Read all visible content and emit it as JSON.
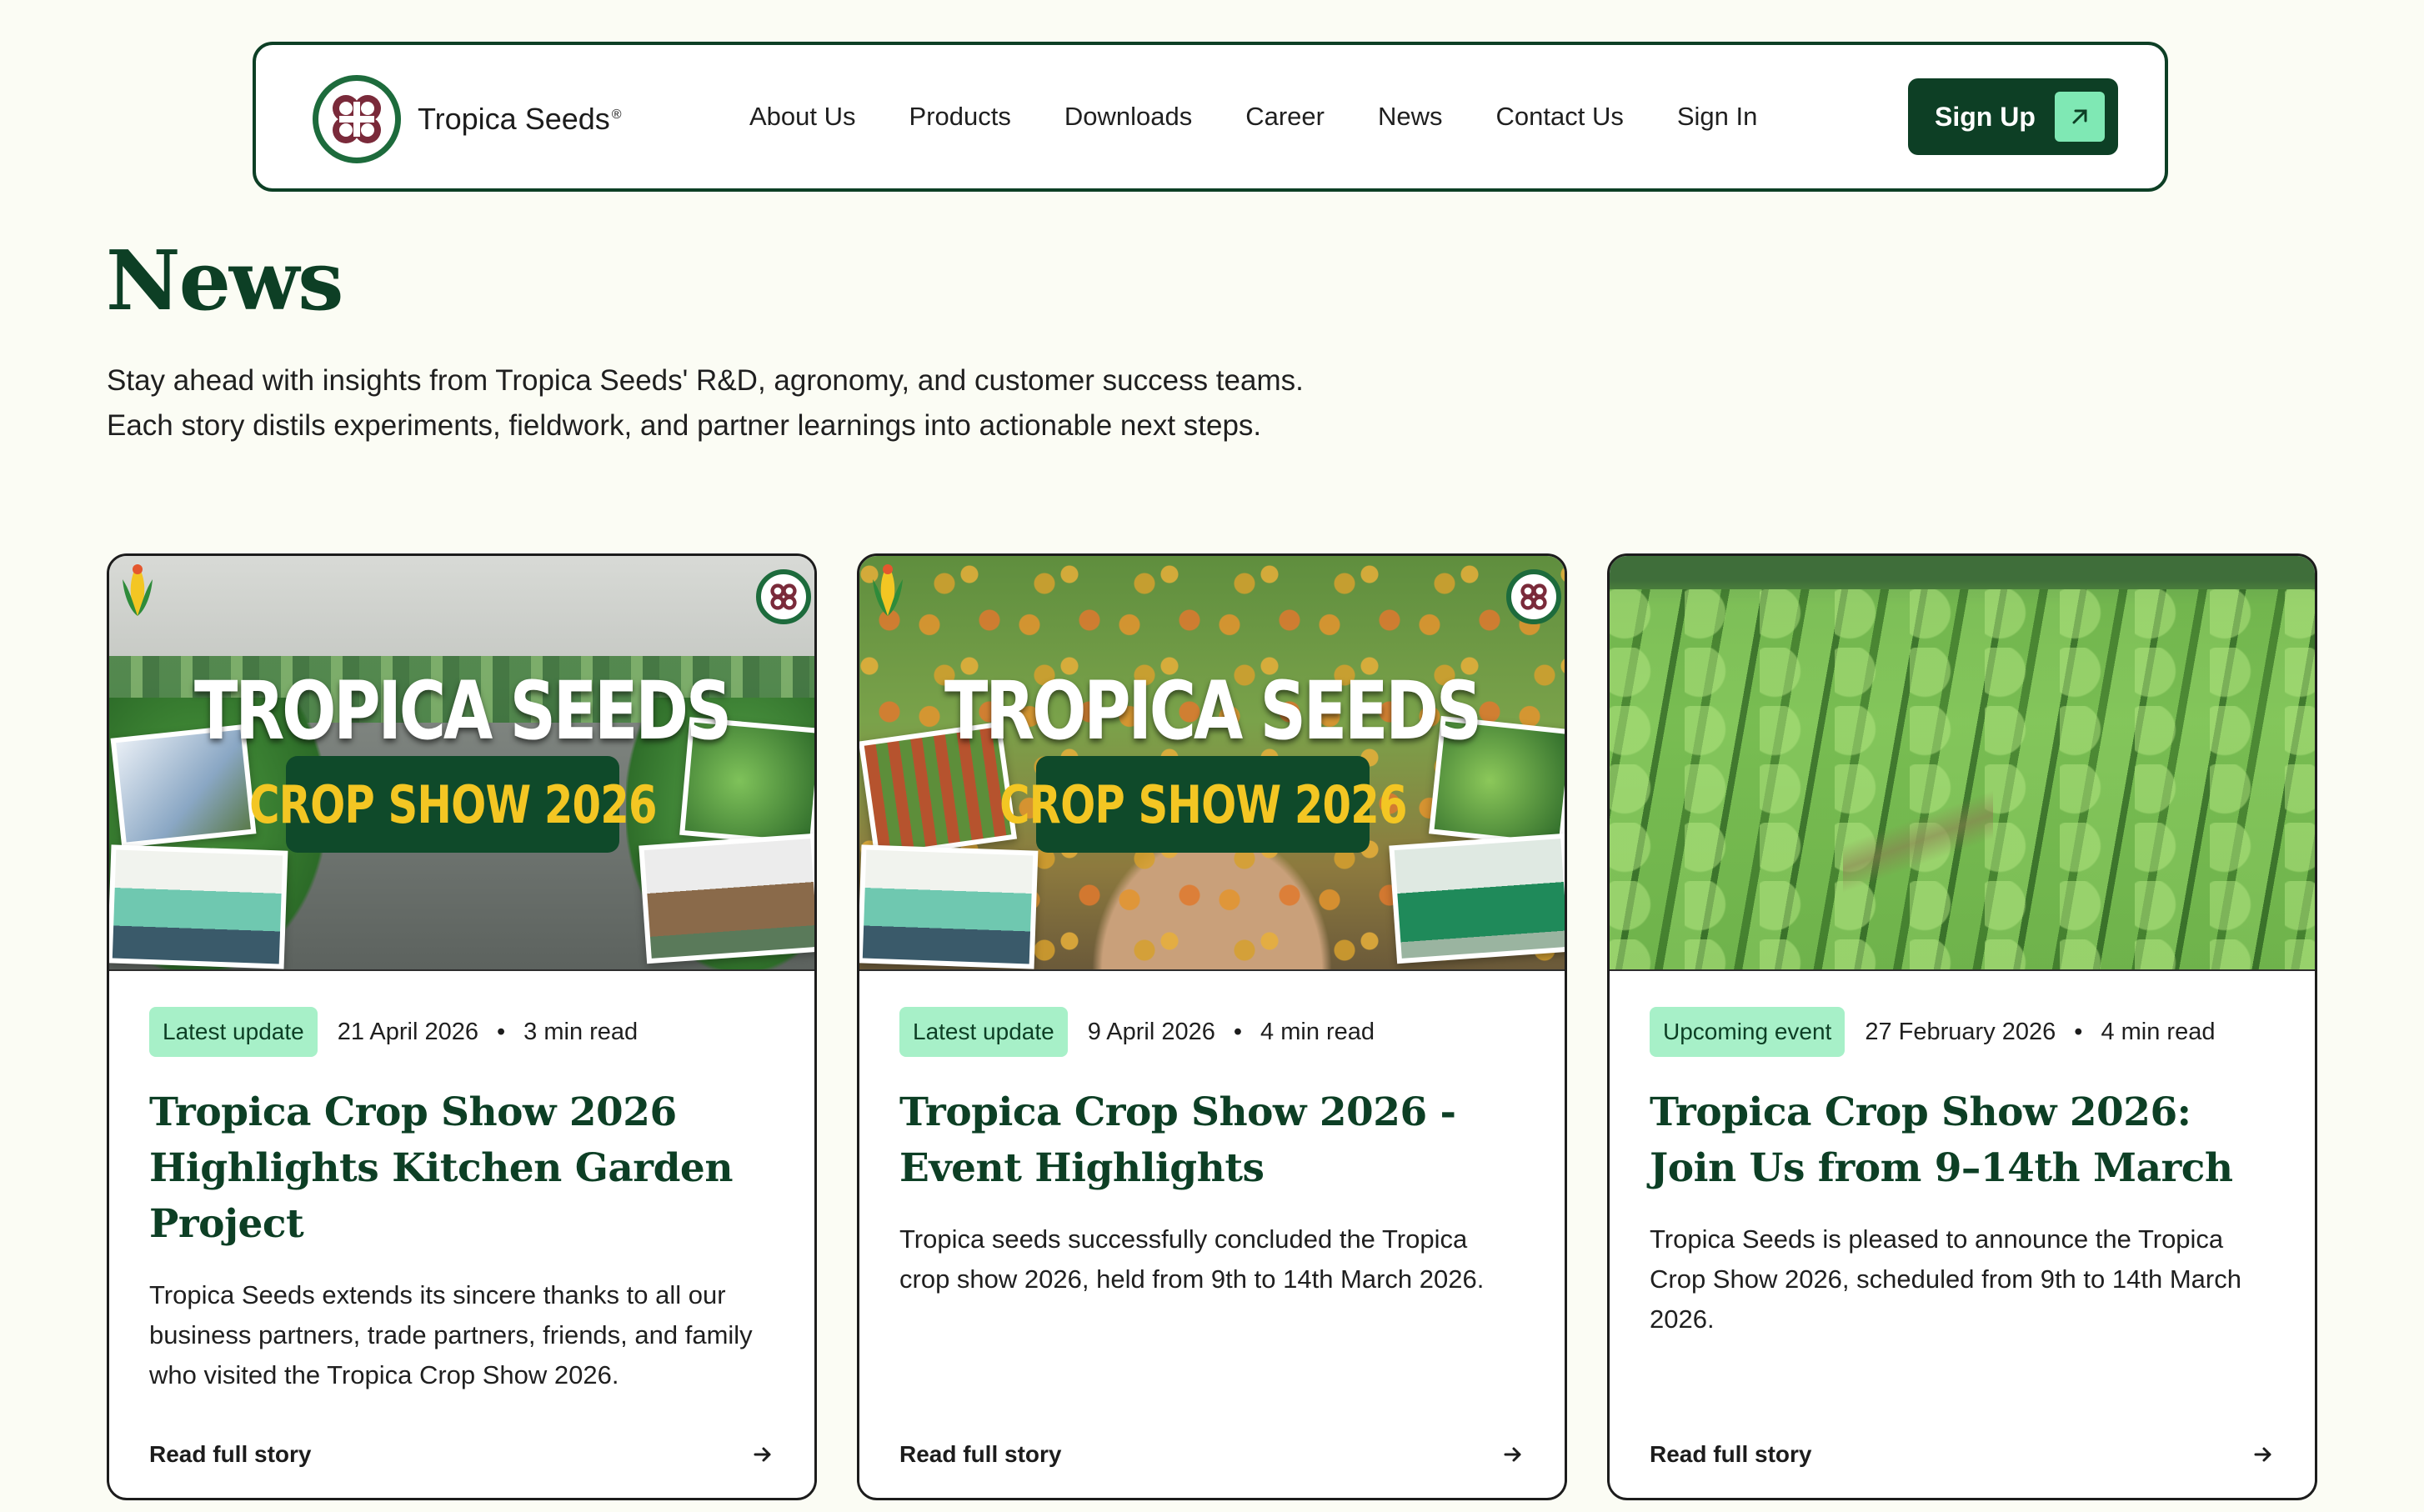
{
  "nav": {
    "brand": "Tropica Seeds",
    "brand_reg": "®",
    "links": [
      "About Us",
      "Products",
      "Downloads",
      "Career",
      "News",
      "Contact Us",
      "Sign In"
    ],
    "signup_label": "Sign Up"
  },
  "header": {
    "title": "News",
    "intro_line1": "Stay ahead with insights from Tropica Seeds' R&D, agronomy, and customer success teams.",
    "intro_line2": "Each story distils experiments, fieldwork, and partner learnings into actionable next steps."
  },
  "cards": [
    {
      "poster_title": "TROPICA SEEDS",
      "poster_sub": "CROP SHOW 2026",
      "badge": "Latest update",
      "date": "21 April 2026",
      "read_time": "3 min read",
      "title": "Tropica Crop Show 2026 Highlights Kitchen Garden Project",
      "desc": "Tropica Seeds extends its sincere thanks to all our business partners, trade partners, friends, and family who visited the Tropica Crop Show 2026.",
      "link": "Read full story"
    },
    {
      "poster_title": "TROPICA SEEDS",
      "poster_sub": "CROP SHOW 2026",
      "badge": "Latest update",
      "date": "9 April 2026",
      "read_time": "4 min read",
      "title": "Tropica Crop Show 2026 - Event Highlights",
      "desc": "Tropica seeds successfully concluded the Tropica crop show 2026, held from 9th to 14th March 2026.",
      "link": "Read full story"
    },
    {
      "badge": "Upcoming event",
      "date": "27 February 2026",
      "read_time": "4 min read",
      "title": "Tropica Crop Show 2026: Join Us from 9–14th March",
      "desc": "Tropica Seeds is pleased to announce the Tropica Crop Show 2026, scheduled from 9th to 14th March 2026.",
      "link": "Read full story"
    }
  ],
  "colors": {
    "brand_green": "#0d3f25",
    "accent_mint": "#a7f0c8",
    "background": "#fbfcf4"
  }
}
